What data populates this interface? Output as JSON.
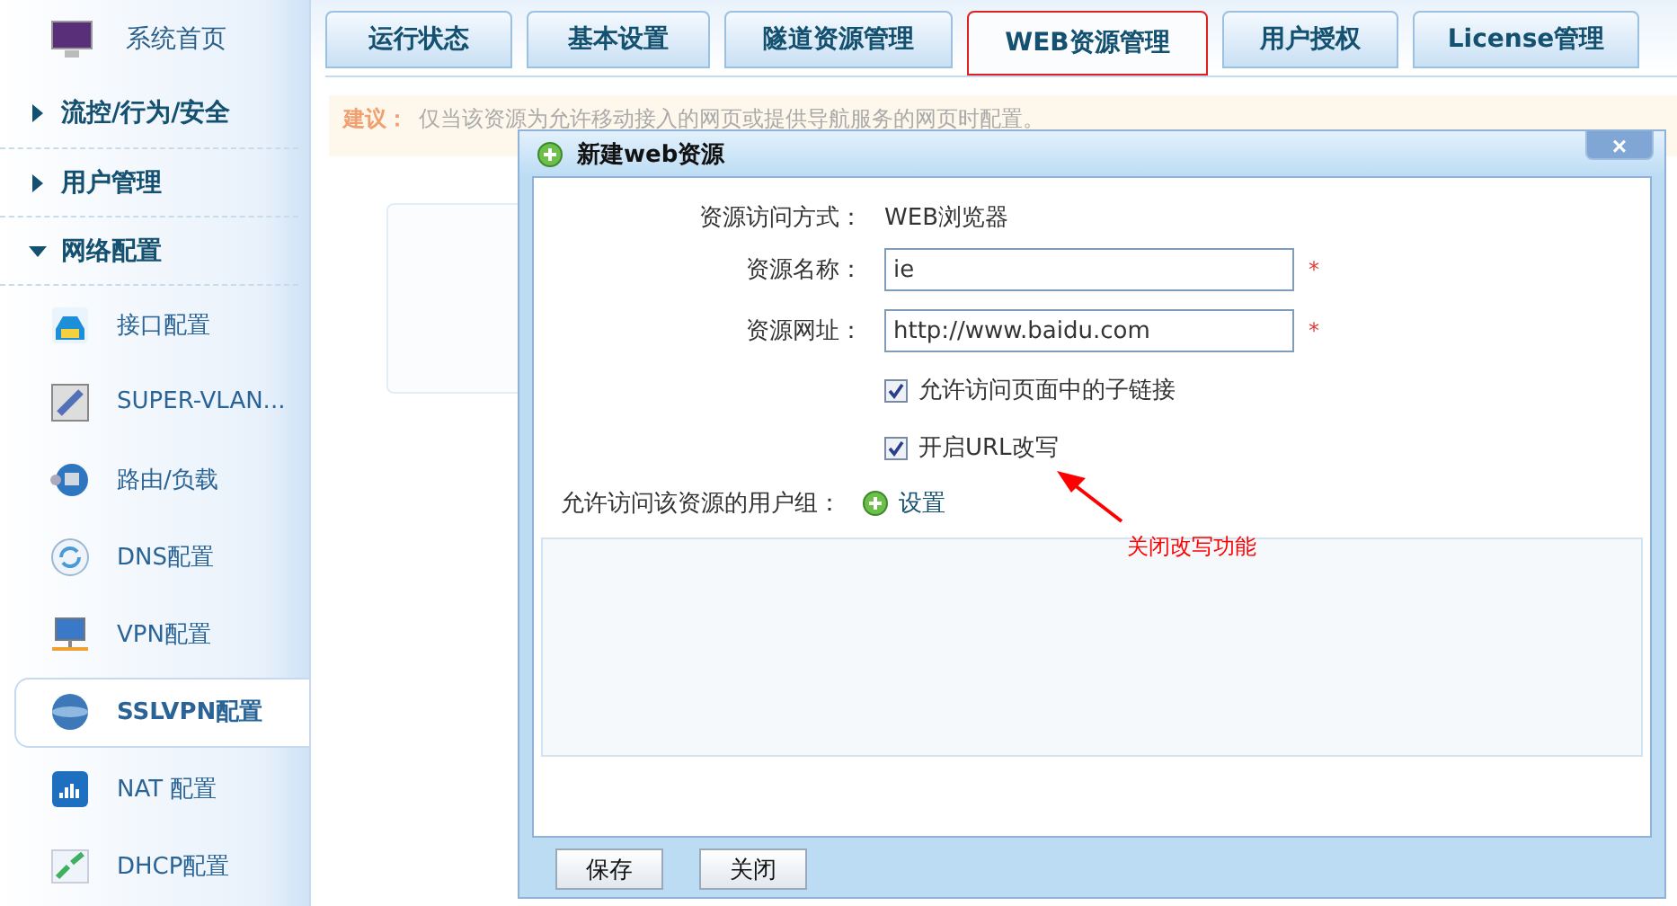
{
  "sidebar": {
    "items": [
      {
        "kind": "home",
        "label": "系统首页",
        "selected": false
      },
      {
        "kind": "section",
        "label": "流控/行为/安全",
        "expanded": false
      },
      {
        "kind": "section",
        "label": "用户管理",
        "expanded": false
      },
      {
        "kind": "section",
        "label": "网络配置",
        "expanded": true,
        "children": [
          {
            "label": "接口配置",
            "selected": false
          },
          {
            "label": "SUPER-VLAN...",
            "selected": false
          },
          {
            "label": "路由/负载",
            "selected": false
          },
          {
            "label": "DNS配置",
            "selected": false
          },
          {
            "label": "VPN配置",
            "selected": false
          },
          {
            "label": "SSLVPN配置",
            "selected": true
          },
          {
            "label": "NAT 配置",
            "selected": false
          },
          {
            "label": "DHCP配置",
            "selected": false
          }
        ]
      }
    ]
  },
  "tabs": [
    {
      "label": "运行状态",
      "selected": false
    },
    {
      "label": "基本设置",
      "selected": false
    },
    {
      "label": "隧道资源管理",
      "selected": false
    },
    {
      "label": "WEB资源管理",
      "selected": true
    },
    {
      "label": "用户授权",
      "selected": false
    },
    {
      "label": "License管理",
      "selected": false
    }
  ],
  "notice": {
    "label": "建议：",
    "text": "仅当该资源为允许移动接入的网页或提供导航服务的网页时配置。"
  },
  "dialog": {
    "title": "新建web资源",
    "close": "×",
    "fields": [
      {
        "kind": "text",
        "label": "资源访问方式：",
        "value": "WEB浏览器"
      },
      {
        "kind": "input",
        "label": "资源名称：",
        "value": "ie",
        "required": "*"
      },
      {
        "kind": "input",
        "label": "资源网址：",
        "value": "http://www.baidu.com",
        "required": "*"
      },
      {
        "kind": "checkbox",
        "label": "允许访问页面中的子链接",
        "checked": true
      },
      {
        "kind": "checkbox",
        "label": "开启URL改写",
        "checked": true
      }
    ],
    "group_label": "允许访问该资源的用户组：",
    "group_link": "设置",
    "buttons": [
      "保存",
      "关闭"
    ]
  },
  "annotation": {
    "text": "关闭改写功能"
  }
}
